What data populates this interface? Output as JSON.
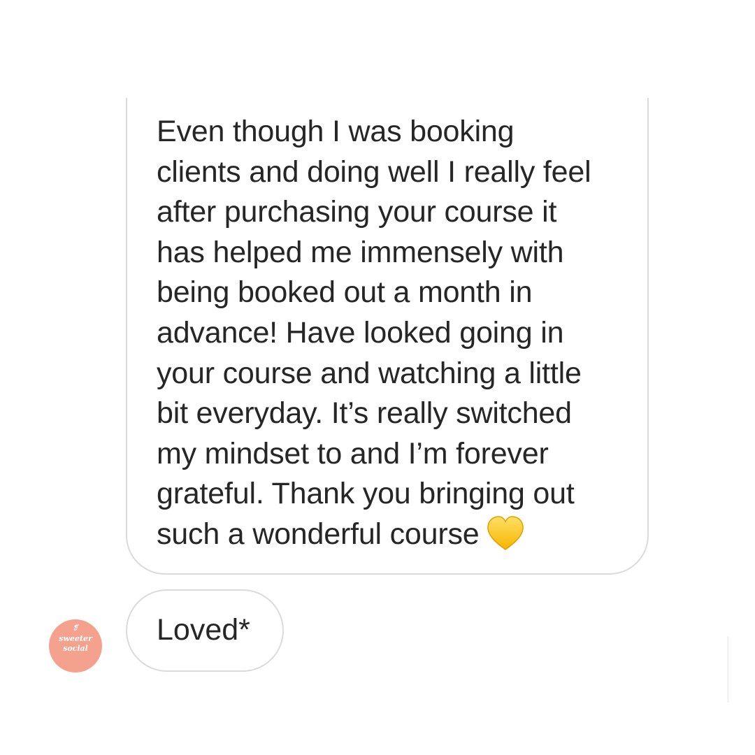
{
  "thread": {
    "messages": [
      {
        "lines": [
          "Even though I was booking",
          "clients and doing well I really feel",
          "after purchasing your course it",
          "has helped me immensely with",
          "being booked out a month in",
          "advance! Have looked going in",
          "your course and watching a little",
          "bit everyday. It’s really switched",
          "my mindset to and I’m forever",
          "grateful. Thank you bringing out",
          "such a wonderful course"
        ],
        "emoji": "yellow-heart-icon"
      },
      {
        "text": "Loved*"
      }
    ]
  },
  "avatar": {
    "mark": "❡",
    "line1": "sweeter",
    "line2": "social",
    "color": "#f4a18e"
  },
  "colors": {
    "bubble_border": "#dbdbdb",
    "text": "#262626",
    "heart": "#ffcc33"
  }
}
